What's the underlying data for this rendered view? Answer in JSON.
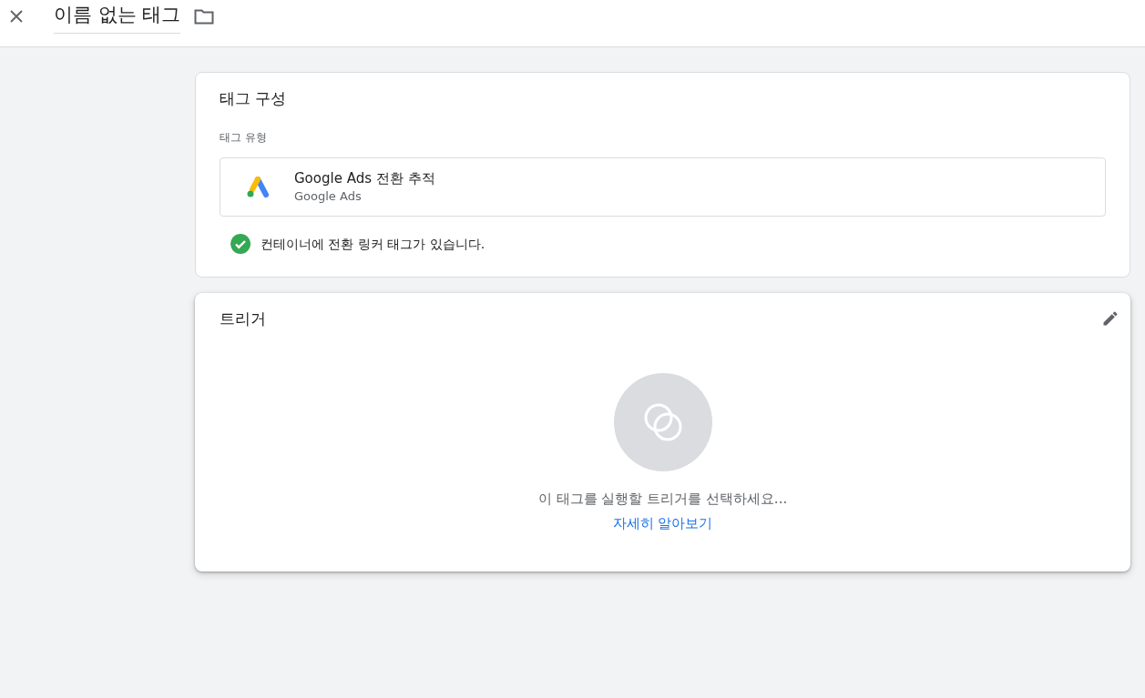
{
  "header": {
    "tag_name": "이름 없는 태그"
  },
  "tag_config": {
    "title": "태그 구성",
    "type_label": "태그 유형",
    "tag_type": {
      "name": "Google Ads 전환 추적",
      "vendor": "Google Ads"
    },
    "notice": {
      "ok": true,
      "text": "컨테이너에 전환 링커 태그가 있습니다."
    }
  },
  "triggers": {
    "title": "트리거",
    "empty_message": "이 태그를 실행할 트리거를 선택하세요...",
    "learn_more": "자세히 알아보기"
  }
}
